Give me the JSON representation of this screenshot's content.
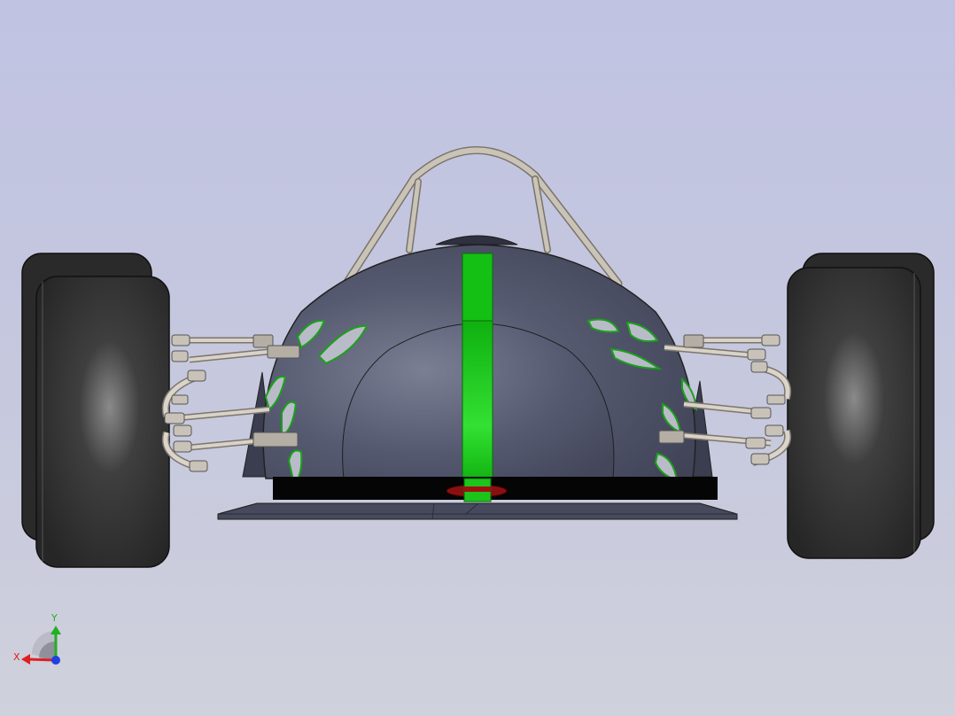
{
  "triad": {
    "y_label": "Y",
    "x_label": "X"
  },
  "colors": {
    "background_top": "#c0c3e2",
    "background_bottom": "#cfd1dc",
    "body_paint": "#50546a",
    "stripe": "#1cc41c",
    "tyre": "#2d2d2d",
    "frame_tube": "#b8b2a8",
    "wing": "#474a5c",
    "axis_x": "#e02020",
    "axis_y": "#20b020",
    "axis_z": "#2040e0"
  },
  "icons": {
    "triad": "view-orientation-triad-icon"
  }
}
